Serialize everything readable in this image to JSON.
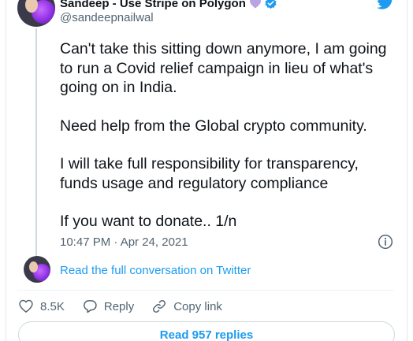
{
  "author": {
    "display_name": "Sandeep - Use Stripe on Polygon",
    "handle": "@sandeepnailwal"
  },
  "tweet": {
    "lines_1": [
      "Can't take this sitting down anymore, I am going",
      "to run a Covid relief campaign in lieu of what's",
      "going on in India."
    ],
    "lines_2": [
      "Need help from the Global crypto community."
    ],
    "lines_3": [
      "I will take full responsibility for transparency,",
      "funds usage and regulatory compliance"
    ],
    "lines_4": [
      "If you want to donate.. 1/n"
    ],
    "timestamp": "10:47 PM · Apr 24, 2021"
  },
  "conversation": {
    "link_text": "Read the full conversation on Twitter"
  },
  "actions": {
    "likes": "8.5K",
    "reply_label": "Reply",
    "copy_link_label": "Copy link"
  },
  "footer": {
    "read_replies_label": "Read 957 replies"
  },
  "colors": {
    "accent": "#1d9bf0",
    "verified": "#1d9bf0",
    "heart": "#b9a3e3",
    "text": "#0f1419",
    "muted": "#536471"
  },
  "icons": [
    "heart-emoji-icon",
    "verified-badge-icon",
    "twitter-bird-icon",
    "info-icon",
    "like-heart-icon",
    "reply-bubble-icon",
    "link-icon"
  ]
}
